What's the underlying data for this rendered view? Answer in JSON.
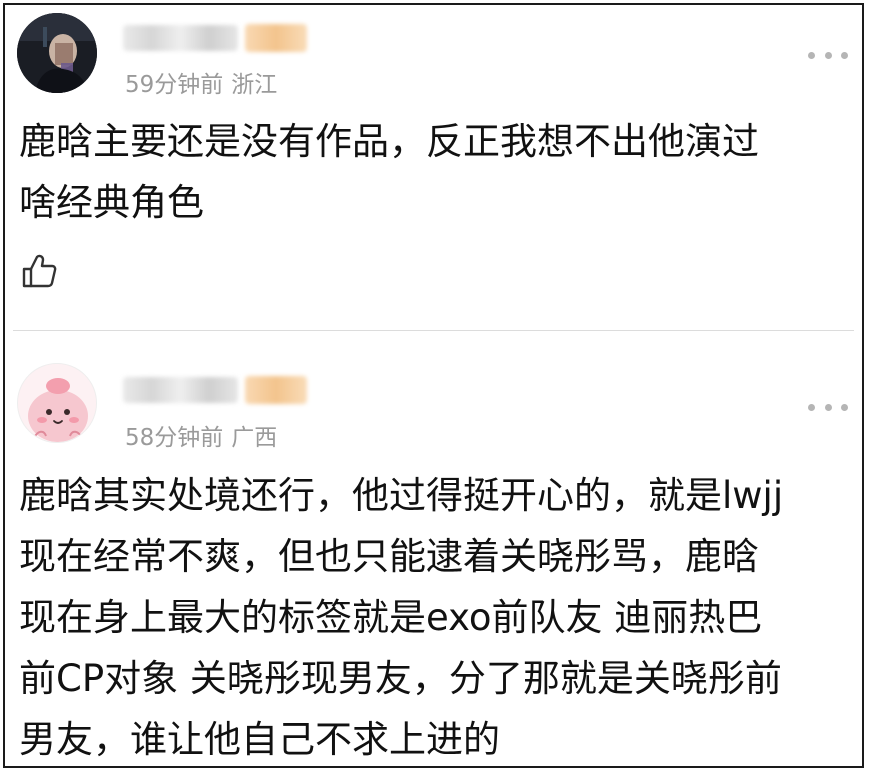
{
  "comments": [
    {
      "time": "59分钟前",
      "location": "浙江",
      "text": "鹿晗主要还是没有作品，反正我想不出他演过\n啥经典角色",
      "icons": [
        "avatar-dark-photo",
        "more-icon",
        "thumbs-up-icon"
      ]
    },
    {
      "time": "58分钟前",
      "location": "广西",
      "text": "鹿晗其实处境还行，他过得挺开心的，就是lwjj\n现在经常不爽，但也只能逮着关晓彤骂，鹿晗\n现在身上最大的标签就是exo前队友 迪丽热巴\n前CP对象 关晓彤现男友，分了那就是关晓彤前\n男友，谁让他自己不求上进的",
      "icons": [
        "avatar-pink-cartoon",
        "more-icon"
      ]
    }
  ],
  "colors": {
    "meta_text": "#9a9a9a",
    "body_text": "#111111",
    "badge": "#f3c48d",
    "frame_border": "#1a1a1a"
  }
}
